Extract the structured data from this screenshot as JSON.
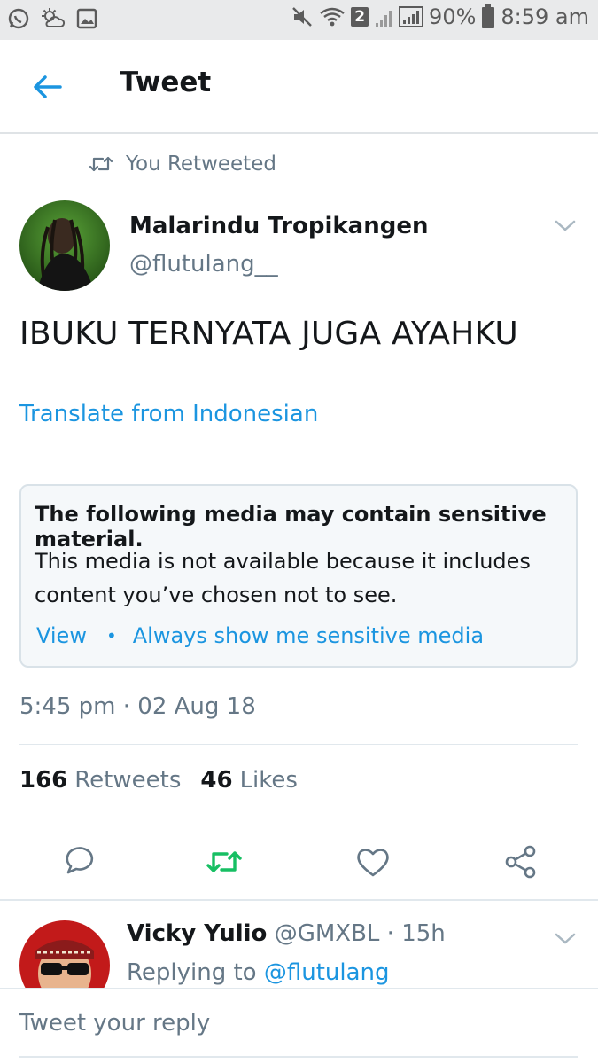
{
  "status_bar": {
    "battery": "90%",
    "time": "8:59 am",
    "sim_badge": "2"
  },
  "app_bar": {
    "title": "Tweet"
  },
  "tweet": {
    "retweet_context": "You Retweeted",
    "author_name": "Malarindu Tropikangen",
    "author_handle": "@flutulang__",
    "text": "IBUKU TERNYATA JUGA AYAHKU",
    "translate_label": "Translate from Indonesian",
    "sensitive": {
      "title": "The following media may contain sensitive material.",
      "body": "This media is not available because it includes content you’ve chosen not to see.",
      "view_label": "View",
      "separator": "•",
      "always_show_label": "Always show me sensitive media"
    },
    "timestamp": "5:45 pm · 02 Aug 18",
    "retweets_count": "166",
    "retweets_label": "Retweets",
    "likes_count": "46",
    "likes_label": "Likes"
  },
  "reply": {
    "name": "Vicky Yulio",
    "meta": "@GMXBL · 15h",
    "replying_prefix": "Replying to",
    "replying_handle": "@flutulang"
  },
  "composer": {
    "placeholder": "Tweet your reply"
  },
  "colors": {
    "accent": "#1b95e0",
    "retweet_active": "#17bf63",
    "secondary_text": "#657786"
  },
  "icons": {
    "back": "arrow-left-icon",
    "retweet_context": "retweet-icon",
    "menu": "chevron-down-icon",
    "reply": "reply-icon",
    "retweet": "retweet-icon",
    "like": "heart-icon",
    "share": "share-icon"
  }
}
